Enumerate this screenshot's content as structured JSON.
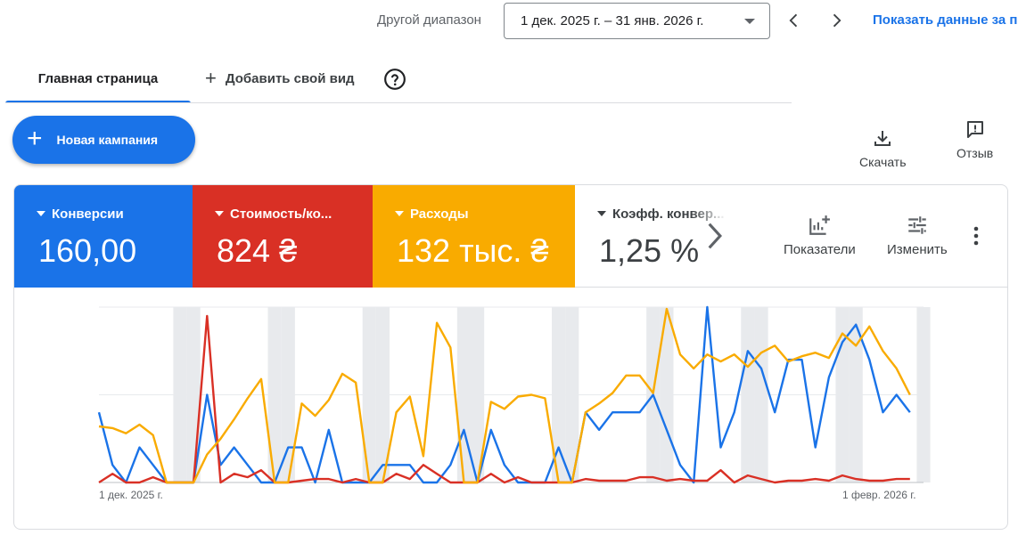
{
  "toolbar": {
    "range_label": "Другой диапазон",
    "range_value": "1 дек. 2025 г. – 31 янв. 2026 г.",
    "show_data_link": "Показать данные за п"
  },
  "tabs": {
    "home": "Главная страница",
    "add_view": "Добавить свой вид"
  },
  "actions": {
    "new_campaign": "Новая кампания",
    "download": "Скачать",
    "feedback": "Отзыв"
  },
  "metrics": [
    {
      "label": "Конверсии",
      "value": "160,00",
      "color": "#1a73e8"
    },
    {
      "label": "Стоимость/ко...",
      "value": "824 ₴",
      "color": "#d93025"
    },
    {
      "label": "Расходы",
      "value": "132 тыс. ₴",
      "color": "#f9ab00"
    },
    {
      "label": "Коэфф. конвер...",
      "value": "1,25 %",
      "color": "#ffffff"
    }
  ],
  "card_tools": {
    "indicators": "Показатели",
    "edit": "Изменить"
  },
  "colors": {
    "accent": "#1a73e8",
    "conversions": "#1a73e8",
    "cost_per_conv": "#d93025",
    "spend": "#f9ab00",
    "weekend_band": "#e8eaed"
  },
  "chart_data": {
    "type": "line",
    "x_start_label": "1 дек. 2025 г.",
    "x_end_label": "1 февр. 2026 г.",
    "x": [
      "1 дек.",
      "2 дек.",
      "3 дек.",
      "4 дек.",
      "5 дек.",
      "6 дек.",
      "7 дек.",
      "8 дек.",
      "9 дек.",
      "10 дек.",
      "11 дек.",
      "12 дек.",
      "13 дек.",
      "14 дек.",
      "15 дек.",
      "16 дек.",
      "17 дек.",
      "18 дек.",
      "19 дек.",
      "20 дек.",
      "21 дек.",
      "22 дек.",
      "23 дек.",
      "24 дек.",
      "25 дек.",
      "26 дек.",
      "27 дек.",
      "28 дек.",
      "29 дек.",
      "30 дек.",
      "31 дек.",
      "1 янв.",
      "2 янв.",
      "3 янв.",
      "4 янв.",
      "5 янв.",
      "6 янв.",
      "7 янв.",
      "8 янв.",
      "9 янв.",
      "10 янв.",
      "11 янв.",
      "12 янв.",
      "13 янв.",
      "14 янв.",
      "15 янв.",
      "16 янв.",
      "17 янв.",
      "18 янв.",
      "19 янв.",
      "20 янв.",
      "21 янв.",
      "22 янв.",
      "23 янв.",
      "24 янв.",
      "25 янв.",
      "26 янв.",
      "27 янв.",
      "28 янв.",
      "29 янв.",
      "30 янв.",
      "31 янв."
    ],
    "weekend_bands": [
      6,
      7,
      13,
      14,
      20,
      21,
      27,
      28,
      34,
      35,
      41,
      42,
      48,
      49,
      55,
      56,
      61
    ],
    "ylim": [
      0,
      1
    ],
    "grid": true,
    "series": [
      {
        "color": "#1a73e8",
        "values": [
          0.4,
          0.1,
          0.0,
          0.2,
          0.1,
          0.0,
          0.0,
          0.0,
          0.5,
          0.1,
          0.2,
          0.1,
          0.0,
          0.0,
          0.2,
          0.2,
          0.0,
          0.3,
          0.0,
          0.0,
          0.0,
          0.1,
          0.1,
          0.1,
          0.0,
          0.0,
          0.1,
          0.3,
          0.0,
          0.3,
          0.1,
          0.0,
          0.0,
          0.0,
          0.2,
          0.0,
          0.4,
          0.3,
          0.4,
          0.4,
          0.4,
          0.5,
          0.3,
          0.1,
          0.0,
          1.0,
          0.2,
          0.4,
          0.75,
          0.65,
          0.4,
          0.7,
          0.7,
          0.2,
          0.6,
          0.8,
          0.9,
          0.7,
          0.4,
          0.5,
          0.4
        ]
      },
      {
        "color": "#d93025",
        "values": [
          0.0,
          0.05,
          0.0,
          0.0,
          0.03,
          0.0,
          0.0,
          0.0,
          0.95,
          0.0,
          0.05,
          0.03,
          0.07,
          0.0,
          0.0,
          0.01,
          0.02,
          0.02,
          0.0,
          0.02,
          0.0,
          0.0,
          0.05,
          0.02,
          0.1,
          0.05,
          0.0,
          0.0,
          0.0,
          0.05,
          0.0,
          0.03,
          0.0,
          0.0,
          0.0,
          0.0,
          0.02,
          0.01,
          0.01,
          0.01,
          0.03,
          0.03,
          0.01,
          0.02,
          0.01,
          0.01,
          0.07,
          0.0,
          0.04,
          0.02,
          0.0,
          0.01,
          0.01,
          0.02,
          0.01,
          0.04,
          0.02,
          0.01,
          0.01,
          0.02,
          0.02
        ]
      },
      {
        "color": "#f9ab00",
        "values": [
          0.32,
          0.31,
          0.28,
          0.33,
          0.27,
          0.0,
          0.0,
          0.0,
          0.16,
          0.25,
          0.36,
          0.48,
          0.59,
          0.0,
          0.0,
          0.45,
          0.38,
          0.47,
          0.62,
          0.57,
          0.0,
          0.0,
          0.4,
          0.49,
          0.15,
          0.91,
          0.77,
          0.0,
          0.0,
          0.46,
          0.42,
          0.49,
          0.5,
          0.48,
          0.0,
          0.0,
          0.4,
          0.45,
          0.51,
          0.61,
          0.61,
          0.51,
          0.99,
          0.73,
          0.65,
          0.73,
          0.69,
          0.73,
          0.66,
          0.74,
          0.78,
          0.69,
          0.72,
          0.74,
          0.71,
          0.85,
          0.78,
          0.89,
          0.75,
          0.65,
          0.5
        ]
      }
    ]
  }
}
